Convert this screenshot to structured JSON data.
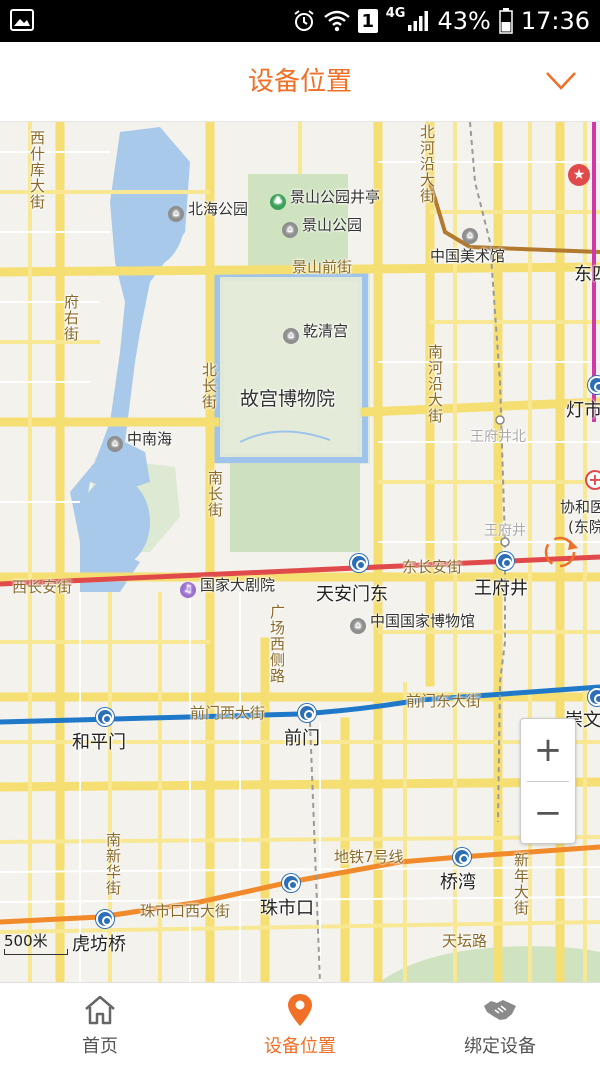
{
  "statusbar": {
    "battery": "43%",
    "time": "17:36",
    "network": "4G",
    "sim": "1"
  },
  "header": {
    "title": "设备位置"
  },
  "map": {
    "labels": {
      "xishiku": "西什库大街",
      "beihai": "北海公园",
      "jingshan_jt": "景山公园井亭",
      "jingshan": "景山公园",
      "jingshanqj": "景山前街",
      "beiheyan": "北河沿大街",
      "meishuguan": "中国美术馆",
      "dong": "东四",
      "fuyou": "府右街",
      "qianqing": "乾清宫",
      "gugong": "故宫博物院",
      "beichang": "北长街",
      "nanheyan": "南河沿大街",
      "dengshi": "灯市",
      "zhongnanhai": "中南海",
      "wangfujing_bei": "王府井北",
      "nanchang": "南长街",
      "xiehe": "协和医",
      "xiehe2": "(东院)",
      "wangfujing_gray": "王府井",
      "xichangan": "西长安街",
      "dongchangan": "东长安街",
      "dajuyuan": "国家大剧院",
      "tiananmendong": "天安门东",
      "wangfujing": "王府井",
      "bowuguan": "中国国家博物馆",
      "guangchang": "广场西侧路",
      "qianmenxi": "前门西大街",
      "qianmendong": "前门东大街",
      "chongwen": "崇文",
      "hepingmen": "和平门",
      "qianmen": "前门",
      "nanxinhua": "南新华街",
      "ditie7": "地铁7号线",
      "qiaowan": "桥湾",
      "xinnian": "新年大街",
      "zhushikou": "珠市口",
      "zhushikouxi": "珠市口西大街",
      "hufangqiao": "虎坊桥",
      "tiantan": "天坛路"
    },
    "scale_label": "500米",
    "zoom": {
      "in": "+",
      "out": "−"
    }
  },
  "tabs": [
    {
      "label": "首页",
      "icon": "home-icon",
      "active": false
    },
    {
      "label": "设备位置",
      "icon": "location-pin-icon",
      "active": true
    },
    {
      "label": "绑定设备",
      "icon": "handshake-icon",
      "active": false
    }
  ],
  "colors": {
    "accent": "#f07028",
    "road": "#f6e27a",
    "line1": "#e04a4a",
    "line2": "#1f78c8",
    "line7": "#f08a2a",
    "line6": "#b27a30"
  }
}
